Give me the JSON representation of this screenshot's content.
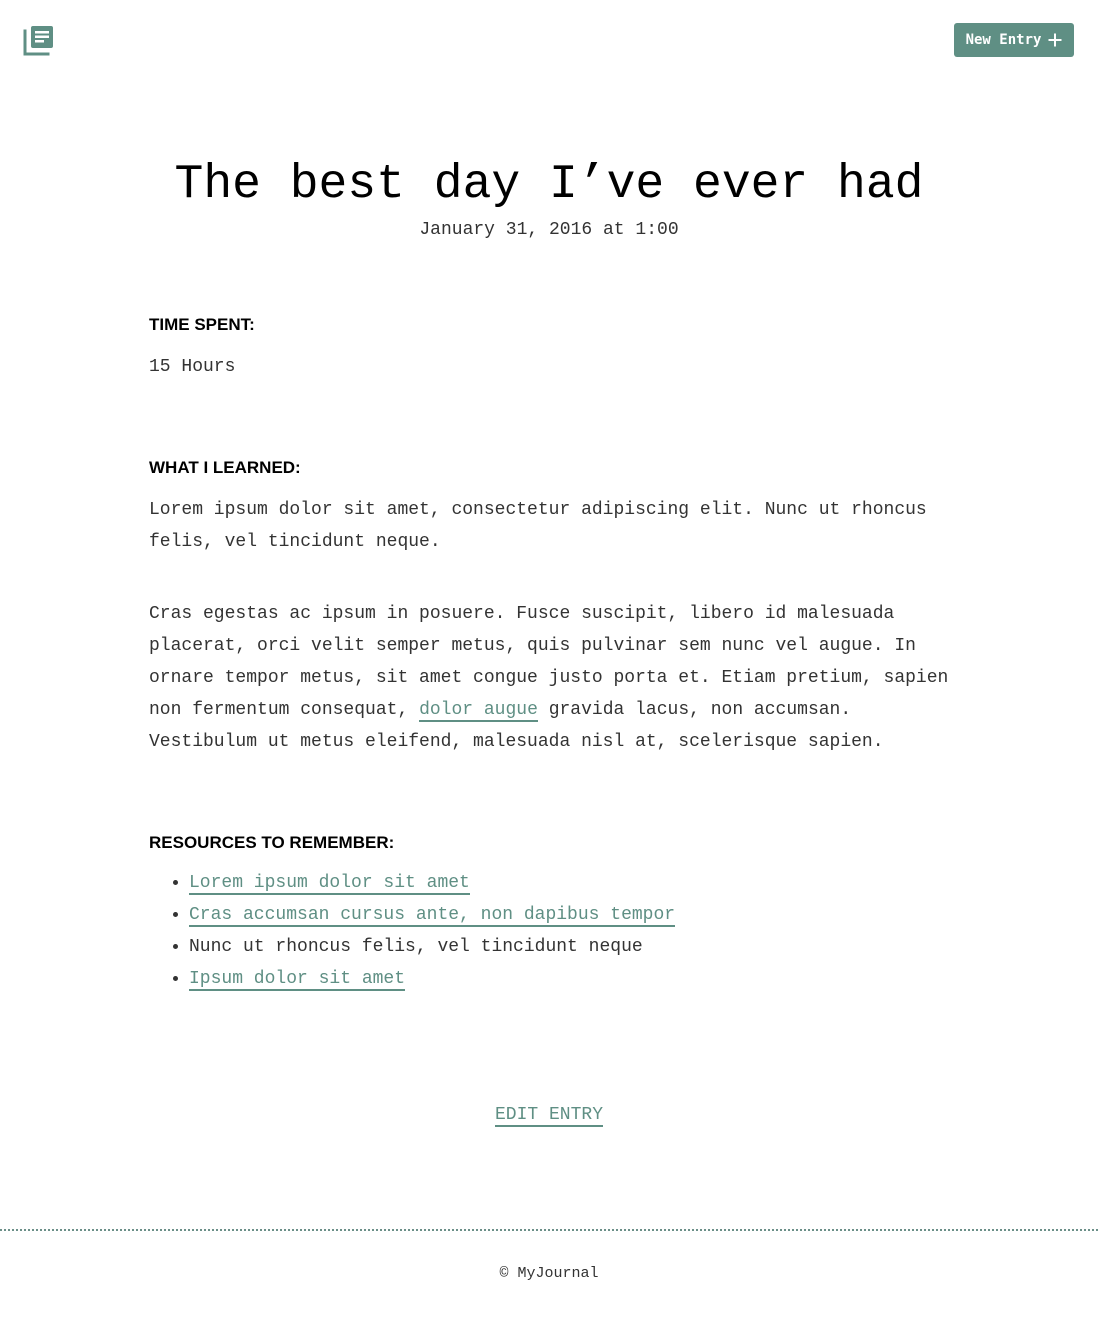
{
  "header": {
    "logo_icon": "journal-icon",
    "new_entry_label": "New Entry",
    "new_entry_icon": "plus-icon",
    "accent_color": "#5f8f84"
  },
  "entry": {
    "title": "The best day I’ve ever had",
    "date": "January 31, 2016 at 1:00",
    "time_spent": {
      "heading": "TIME SPENT:",
      "value": "15 Hours"
    },
    "learned": {
      "heading": "WHAT I LEARNED:",
      "paragraph1": "Lorem ipsum dolor sit amet, consectetur adipiscing elit. Nunc ut rhoncus felis, vel tincidunt neque.",
      "paragraph2_before": "Cras egestas ac ipsum in posuere. Fusce suscipit, libero id malesuada placerat, orci velit semper metus, quis pulvinar sem nunc vel augue. In ornare tempor metus, sit amet congue justo porta et. Etiam pretium, sapien non fermentum consequat,",
      "paragraph2_link": "dolor augue",
      "paragraph2_after": "gravida lacus, non accumsan. Vestibulum ut metus eleifend, malesuada nisl at, scelerisque sapien."
    },
    "resources": {
      "heading": "RESOURCES TO REMEMBER:",
      "items": [
        {
          "label": "Lorem ipsum dolor sit amet",
          "is_link": true
        },
        {
          "label": "Cras accumsan cursus ante, non dapibus tempor",
          "is_link": true
        },
        {
          "label": "Nunc ut rhoncus felis, vel tincidunt neque",
          "is_link": false
        },
        {
          "label": "Ipsum dolor sit amet",
          "is_link": true
        }
      ]
    },
    "edit_label": "EDIT ENTRY"
  },
  "footer": {
    "text": "© MyJournal"
  }
}
